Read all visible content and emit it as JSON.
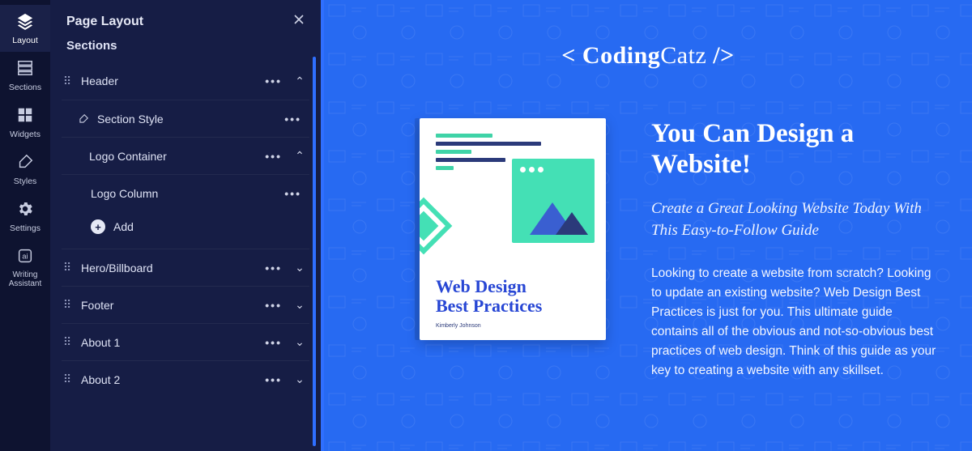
{
  "rail": {
    "items": [
      {
        "label": "Layout",
        "icon": "layers",
        "active": true
      },
      {
        "label": "Sections",
        "icon": "sections"
      },
      {
        "label": "Widgets",
        "icon": "widgets"
      },
      {
        "label": "Styles",
        "icon": "brush"
      },
      {
        "label": "Settings",
        "icon": "gear"
      },
      {
        "label": "Writing Assistant",
        "icon": "ai",
        "multiline": true
      }
    ]
  },
  "panel": {
    "title": "Page Layout",
    "subtitle": "Sections",
    "rows": [
      {
        "kind": "section",
        "label": "Header",
        "expanded": true
      },
      {
        "kind": "style",
        "label": "Section Style"
      },
      {
        "kind": "container",
        "label": "Logo Container",
        "expanded": true
      },
      {
        "kind": "column",
        "label": "Logo Column"
      },
      {
        "kind": "add",
        "label": "Add"
      },
      {
        "kind": "section",
        "label": "Hero/Billboard",
        "expanded": false
      },
      {
        "kind": "section",
        "label": "Footer",
        "expanded": false
      },
      {
        "kind": "section",
        "label": "About 1",
        "expanded": false
      },
      {
        "kind": "section",
        "label": "About 2",
        "expanded": false
      }
    ]
  },
  "canvas": {
    "brand_prefix": "< ",
    "brand_bold": "Coding",
    "brand_thin": "Catz",
    "brand_suffix": " />",
    "book_title_line1": "Web Design",
    "book_title_line2": "Best Practices",
    "book_author": "Kimberly Johnson",
    "headline": "You Can Design a Website!",
    "subhead": "Create a Great Looking Website Today With This Easy-to-Follow Guide",
    "body": "Looking to create a website from scratch? Looking to update an existing website? Web Design Best Practices is just for you. This ultimate guide contains all of the obvious and not-so-obvious best practices of web design. Think of this guide as your key to creating a website with any skillset."
  }
}
